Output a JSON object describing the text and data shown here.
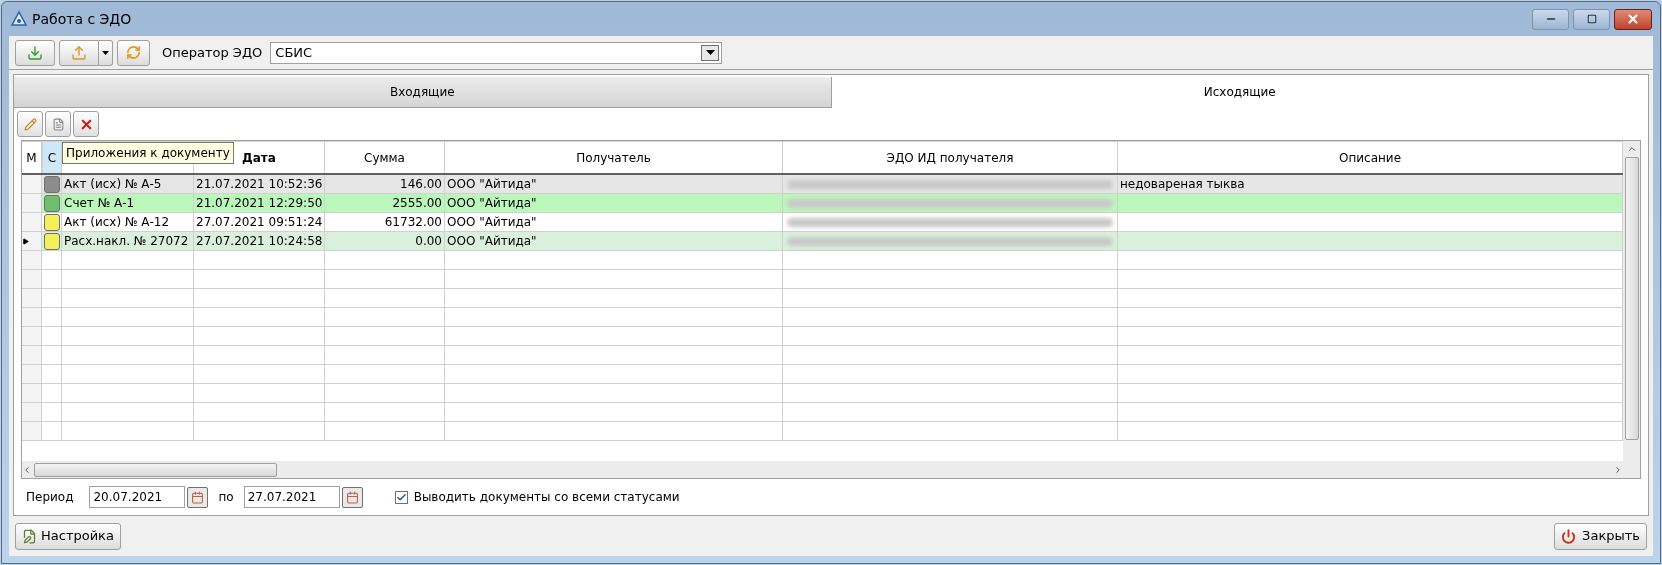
{
  "window": {
    "title": "Работа с ЭДО"
  },
  "toolbar": {
    "operator_label": "Оператор ЭДО",
    "operator_value": "СБИС"
  },
  "tabs": [
    {
      "label": "Входящие",
      "selected": false
    },
    {
      "label": "Исходящие",
      "selected": true
    }
  ],
  "tooltip": "Приложения к документу",
  "table": {
    "columns": [
      "М",
      "С",
      "",
      "Дата",
      "Сумма",
      "Получатель",
      "ЭДО ИД  получателя",
      "Описание"
    ],
    "rows": [
      {
        "color": "#8c8c8c",
        "current": false,
        "number": "Акт (исх) № А-5",
        "date": "21.07.2021 10:52:36",
        "sum": "146.00",
        "recipient": "ООО \"Айтида\"",
        "description": "недовареная тыква"
      },
      {
        "color": "#6fbf6f",
        "current": false,
        "number": "Счет № А-1",
        "date": "21.07.2021 12:29:50",
        "sum": "2555.00",
        "recipient": "ООО \"Айтида\""
      },
      {
        "color": "#f5ef5a",
        "current": false,
        "number": "Акт (исх) № А-12",
        "date": "27.07.2021 09:51:24",
        "sum": "61732.00",
        "recipient": "ООО \"Айтида\""
      },
      {
        "color": "#f5ef5a",
        "current": true,
        "number": "Расх.накл. № 27072",
        "date": "27.07.2021 10:24:58",
        "sum": "0.00",
        "recipient": "ООО \"Айтида\""
      }
    ]
  },
  "period": {
    "label": "Период",
    "from": "20.07.2021",
    "to_label": "по",
    "to": "27.07.2021"
  },
  "all_statuses": {
    "label": "Выводить документы со всеми статусами",
    "checked": true
  },
  "buttons": {
    "settings": "Настройка",
    "close": "Закрыть"
  }
}
